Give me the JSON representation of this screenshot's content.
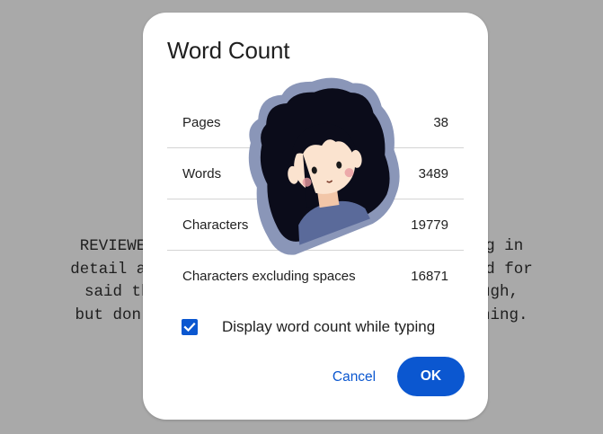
{
  "document": {
    "lines": [
      "REVIEWERS NOTE: Any scenes that seem lacking in",
      "detail are due to my not having it in my head for",
      "said thing. Try to approach this mind through,",
      "but don’t let it bog you down too much anything."
    ]
  },
  "dialog": {
    "title": "Word Count",
    "stats": [
      {
        "label": "Pages",
        "value": "38"
      },
      {
        "label": "Words",
        "value": "3489"
      },
      {
        "label": "Characters",
        "value": "19779"
      },
      {
        "label": "Characters excluding spaces",
        "value": "16871"
      }
    ],
    "checkbox": {
      "label": "Display word count while typing",
      "checked": true
    },
    "cancel_label": "Cancel",
    "ok_label": "OK"
  },
  "colors": {
    "accent": "#0b57d0",
    "backdrop": "#a9a9a9",
    "sticker_outline": "#8a96b8",
    "sticker_hair": "#0b0c1a"
  },
  "icons": {
    "checkbox": "check-icon",
    "sticker": "avatar-sticker-icon"
  }
}
